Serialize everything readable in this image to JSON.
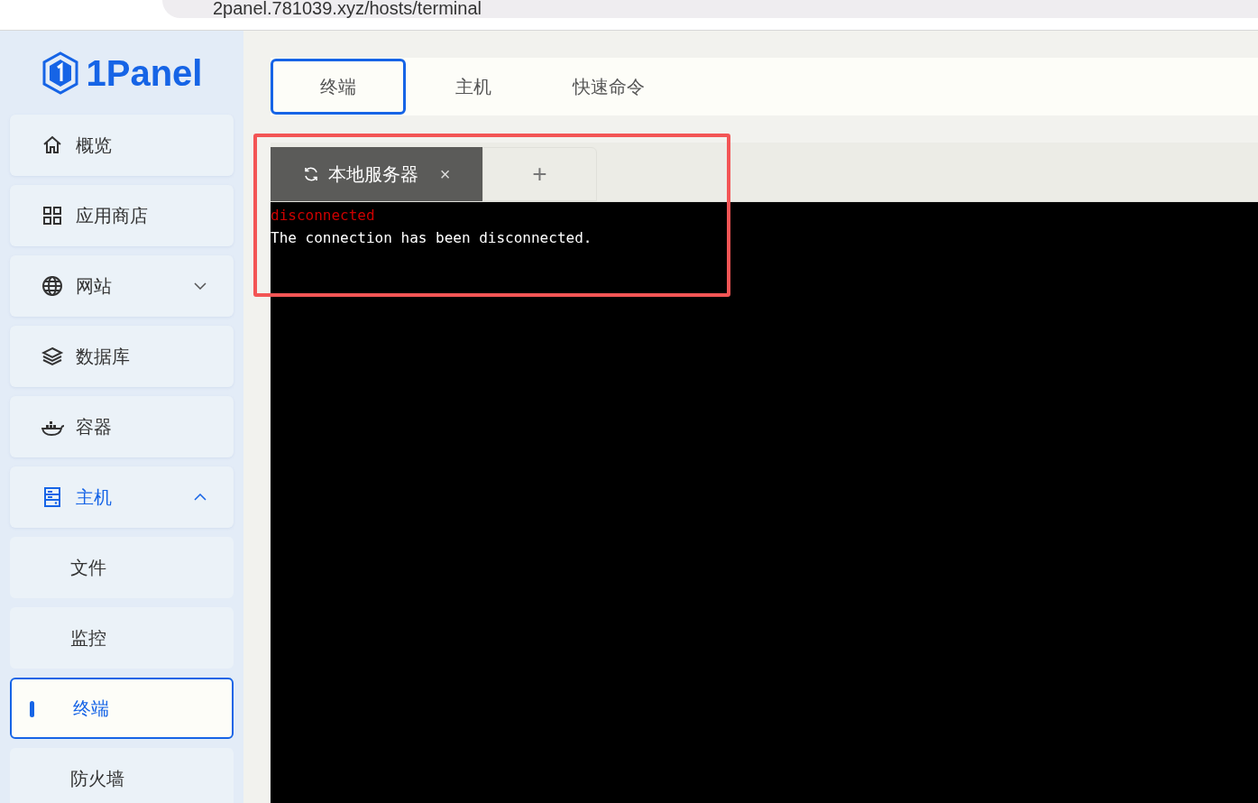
{
  "browser": {
    "address": "2panel.781039.xyz/hosts/terminal"
  },
  "logo": {
    "text": "1Panel"
  },
  "sidebar": {
    "items": [
      {
        "label": "概览",
        "kind": "home",
        "selected": false
      },
      {
        "label": "应用商店",
        "kind": "grid",
        "selected": false
      },
      {
        "label": "网站",
        "kind": "globe",
        "selected": false,
        "expanded": false
      },
      {
        "label": "数据库",
        "kind": "layers",
        "selected": false
      },
      {
        "label": "容器",
        "kind": "whale",
        "selected": false
      },
      {
        "label": "主机",
        "kind": "server",
        "selected": true,
        "expanded": true,
        "children": [
          {
            "label": "文件",
            "selected": false
          },
          {
            "label": "监控",
            "selected": false
          },
          {
            "label": "终端",
            "selected": true
          },
          {
            "label": "防火墙",
            "selected": false
          }
        ]
      }
    ]
  },
  "tabs": [
    {
      "label": "终端",
      "selected": true
    },
    {
      "label": "主机",
      "selected": false
    },
    {
      "label": "快速命令",
      "selected": false
    }
  ],
  "terminal_tabs": [
    {
      "label": "本地服务器",
      "close": "×",
      "selected": true
    }
  ],
  "add_tab": "+",
  "terminal": {
    "lines": [
      {
        "text": "disconnected",
        "kind": "error"
      },
      {
        "text": "The connection has been disconnected.",
        "kind": "normal"
      }
    ]
  },
  "annotation": {
    "shown": true
  }
}
